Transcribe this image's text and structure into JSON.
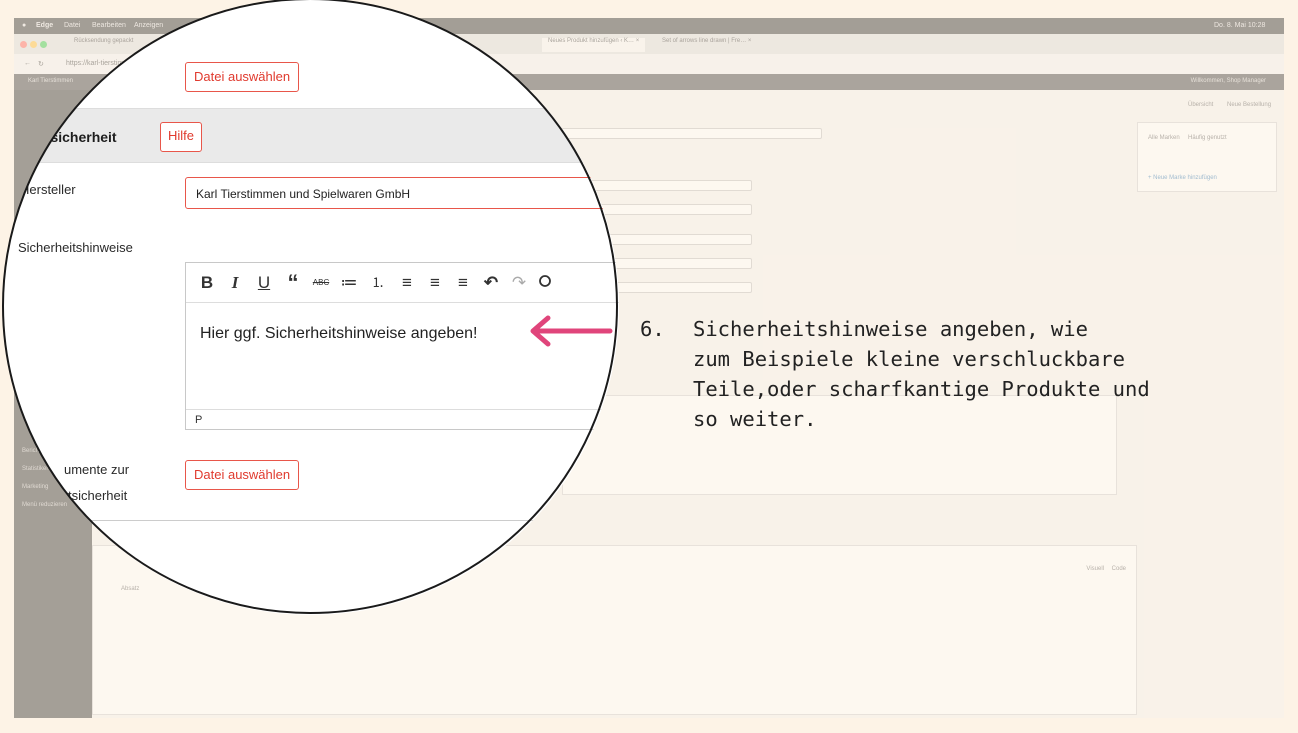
{
  "background": {
    "menubar": {
      "app": "Edge",
      "items": [
        "Datei",
        "Bearbeiten",
        "Anzeigen"
      ],
      "clock": "Do. 8. Mai 10:28"
    },
    "tabs": [
      "Rücksendung gepackt",
      "Neues Produkt hinzufügen ‹ K… ×",
      "Set of arrows line drawn | Fre… ×"
    ],
    "address": "https://karl-tierstimmen…",
    "admin_bar": {
      "site": "Karl Tierstimmen",
      "welcome": "Willkommen, Shop Manager"
    },
    "right_panel": {
      "tabs": [
        "Alle Marken",
        "Häufig genutzt"
      ],
      "link": "+ Neue Marke hinzufügen"
    },
    "right_actions": [
      "Übersicht",
      "Neue Bestellung"
    ],
    "sidebar_items": [
      "Berichte",
      "Statistiken",
      "Marketing",
      "Menü reduzieren"
    ],
    "panel_tabs": [
      "Visuell",
      "Code"
    ],
    "block_select": "Absatz"
  },
  "magnifier": {
    "top_file_button": "Datei auswählen",
    "section_title": "ktsicherheit",
    "help_button": "Hilfe",
    "manufacturer_label": "Hersteller",
    "manufacturer_value": "Karl Tierstimmen und Spielwaren GmbH",
    "safety_label": "Sicherheitshinweise",
    "toolbar": [
      "B",
      "I",
      "U",
      "“",
      "ABC",
      "≔",
      "⒈",
      "≡",
      "≡",
      "≡",
      "↶",
      "↷"
    ],
    "editor_text": "Hier ggf. Sicherheitshinweise angeben!",
    "editor_status": "P",
    "docs_label_line1": "umente zur",
    "docs_label_line2": "tsicherheit",
    "bottom_file_button": "Datei auswählen"
  },
  "annotation": {
    "number": "6.",
    "text": "Sicherheitshinweise angeben, wie\nzum Beispiele kleine verschluckbare\nTeile,oder scharfkantige Produkte und\nso weiter.",
    "arrow_color": "#e0457b"
  }
}
